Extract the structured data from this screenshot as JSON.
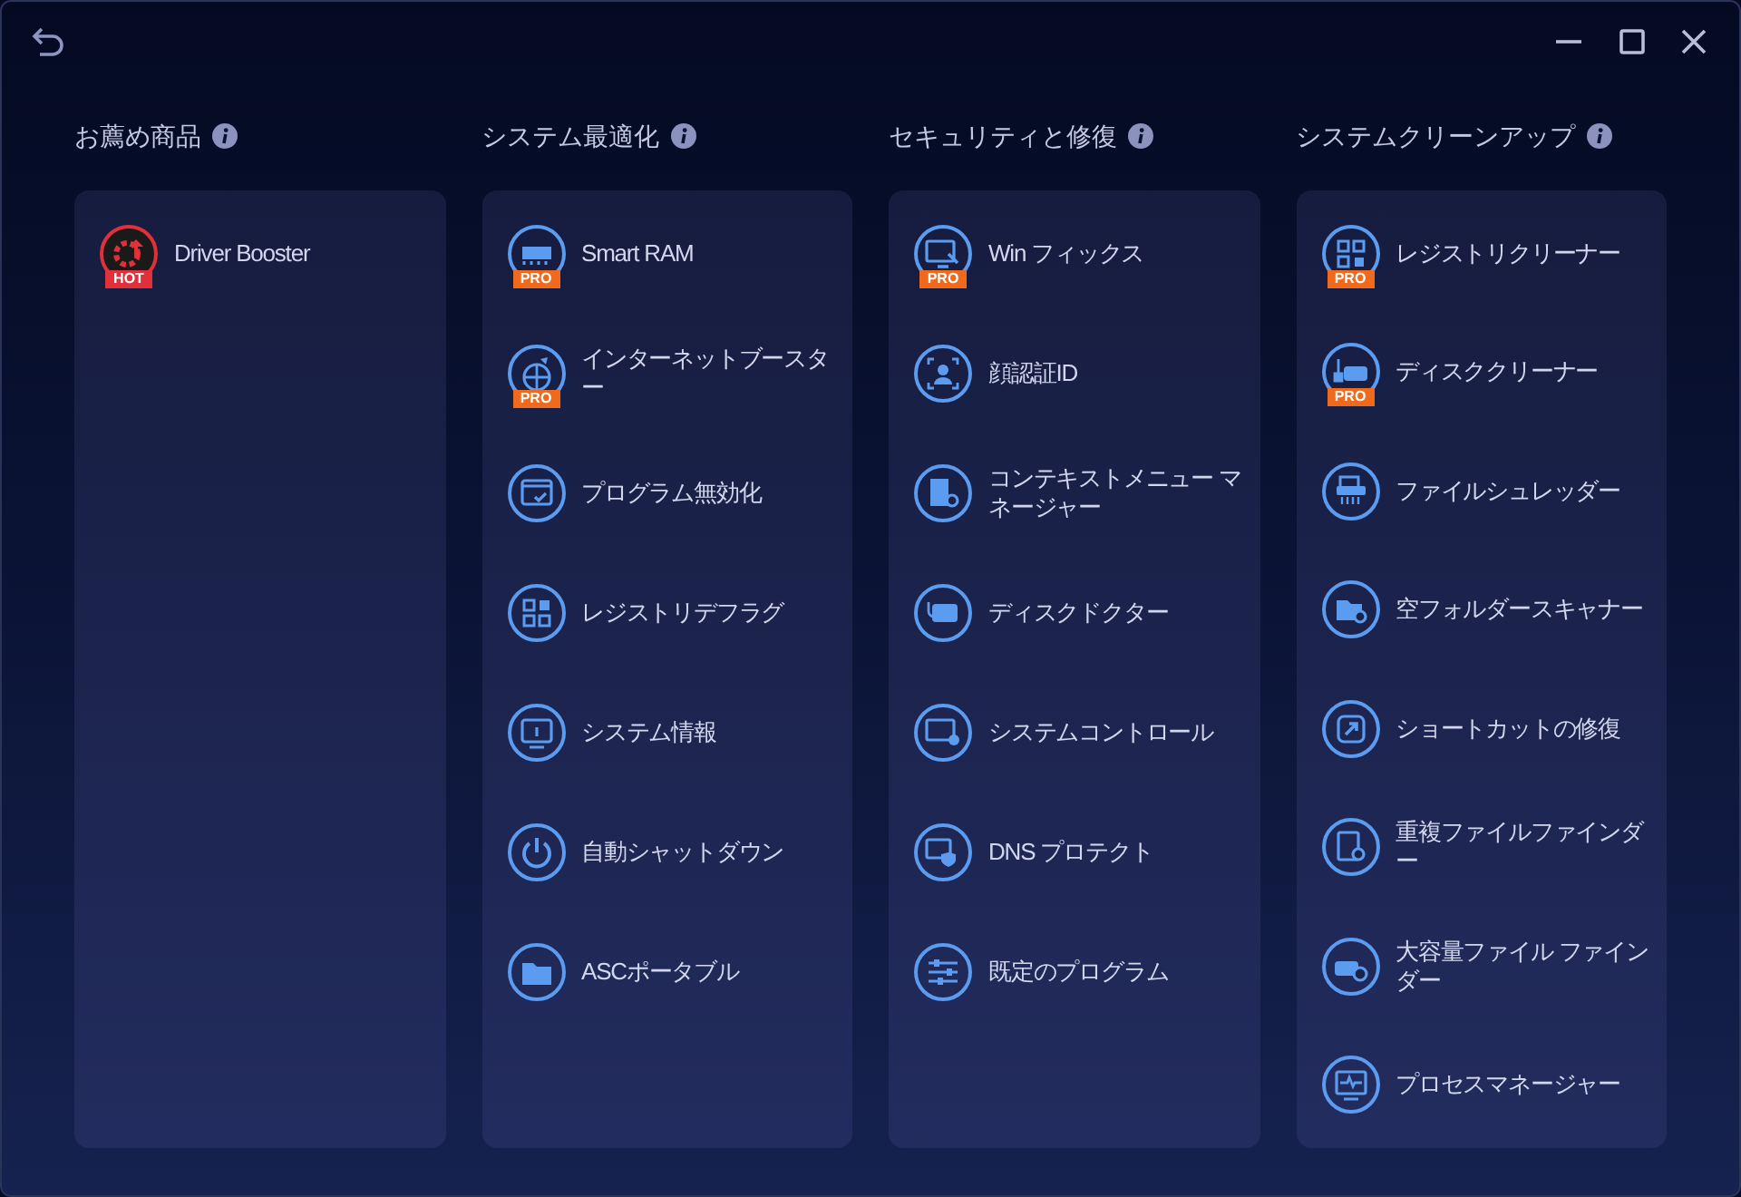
{
  "sections": [
    {
      "title": "お薦め商品",
      "items": [
        {
          "label": "Driver Booster",
          "badge": {
            "text": "HOT",
            "kind": "hot"
          }
        }
      ]
    },
    {
      "title": "システム最適化",
      "items": [
        {
          "label": "Smart RAM",
          "badge": {
            "text": "PRO",
            "kind": "pro"
          }
        },
        {
          "label": "インターネットブースター",
          "badge": {
            "text": "PRO",
            "kind": "pro"
          }
        },
        {
          "label": "プログラム無効化"
        },
        {
          "label": "レジストリデフラグ"
        },
        {
          "label": "システム情報"
        },
        {
          "label": "自動シャットダウン"
        },
        {
          "label": "ASCポータブル"
        }
      ]
    },
    {
      "title": "セキュリティと修復",
      "items": [
        {
          "label": "Win フィックス",
          "badge": {
            "text": "PRO",
            "kind": "pro"
          }
        },
        {
          "label": "顔認証ID"
        },
        {
          "label": "コンテキストメニュー マネージャー"
        },
        {
          "label": "ディスクドクター"
        },
        {
          "label": "システムコントロール"
        },
        {
          "label": "DNS プロテクト"
        },
        {
          "label": "既定のプログラム"
        }
      ]
    },
    {
      "title": "システムクリーンアップ",
      "items": [
        {
          "label": "レジストリクリーナー",
          "badge": {
            "text": "PRO",
            "kind": "pro"
          }
        },
        {
          "label": "ディスククリーナー",
          "badge": {
            "text": "PRO",
            "kind": "pro"
          }
        },
        {
          "label": "ファイルシュレッダー"
        },
        {
          "label": "空フォルダースキャナー"
        },
        {
          "label": "ショートカットの修復"
        },
        {
          "label": "重複ファイルファインダー"
        },
        {
          "label": "大容量ファイル ファインダー"
        },
        {
          "label": "プロセスマネージャー"
        }
      ]
    }
  ]
}
